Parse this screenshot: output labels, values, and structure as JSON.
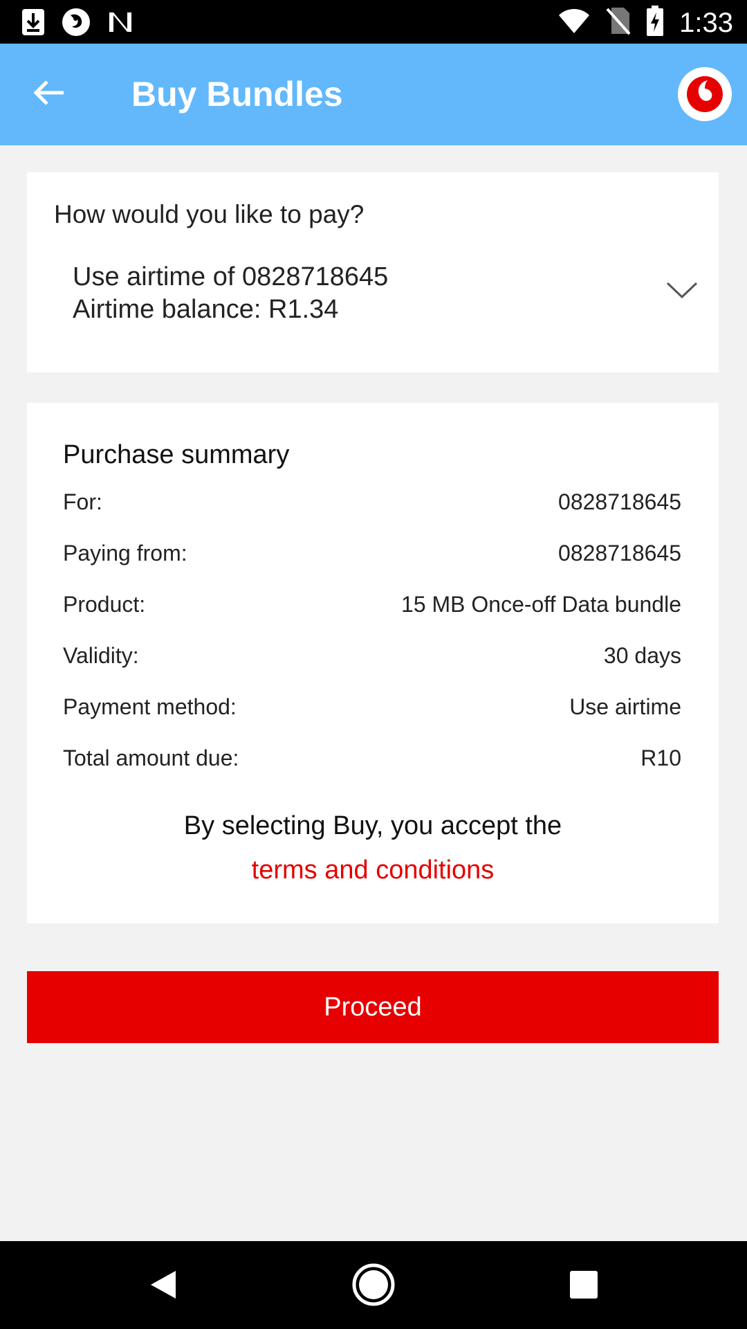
{
  "status_bar": {
    "time": "1:33",
    "icons": [
      "download-icon",
      "firefox-icon",
      "n-icon",
      "wifi-icon",
      "no-sim-icon",
      "battery-charging-icon"
    ]
  },
  "app_bar": {
    "title": "Buy Bundles",
    "back_icon": "arrow-left-icon",
    "logo_icon": "vodafone-logo-icon",
    "color": "#62b8fb"
  },
  "payment": {
    "question": "How would you like to pay?",
    "selected_line1": "Use airtime of 0828718645",
    "selected_line2": "Airtime balance: R1.34"
  },
  "summary": {
    "title": "Purchase summary",
    "rows": [
      {
        "label": "For:",
        "value": "0828718645"
      },
      {
        "label": "Paying from:",
        "value": "0828718645"
      },
      {
        "label": "Product:",
        "value": "15 MB Once-off Data bundle"
      },
      {
        "label": "Validity:",
        "value": "30 days"
      },
      {
        "label": "Payment method:",
        "value": "Use airtime"
      },
      {
        "label": "Total amount due:",
        "value": "R10"
      }
    ],
    "terms_text": "By selecting Buy, you accept the",
    "terms_link": "terms and conditions"
  },
  "proceed_label": "Proceed",
  "colors": {
    "accent": "#e60000",
    "app_bar": "#62b8fb",
    "background": "#f2f2f2"
  }
}
